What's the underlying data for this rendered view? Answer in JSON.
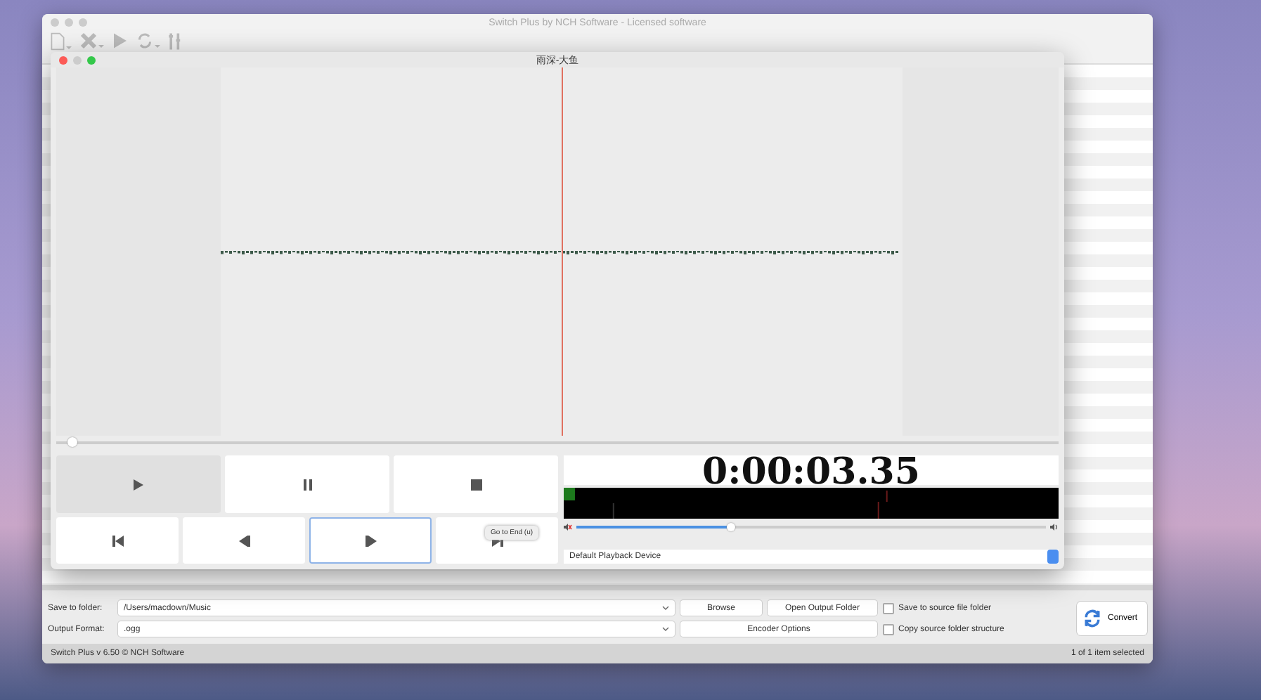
{
  "main_window": {
    "title": "Switch Plus by NCH Software - Licensed software",
    "toolbar": [
      {
        "kind": "add"
      },
      {
        "kind": "remove"
      },
      {
        "kind": "play"
      },
      {
        "kind": "convert"
      },
      {
        "kind": "tools"
      }
    ],
    "save_to_folder": {
      "label": "Save to folder:",
      "value": "/Users/macdown/Music"
    },
    "output_format": {
      "label": "Output Format:",
      "value": ".ogg"
    },
    "buttons": [
      "Browse",
      "Open Output Folder",
      "Encoder Options"
    ],
    "checkboxes": [
      {
        "label": "Save to source file folder",
        "checked": false
      },
      {
        "label": "Copy source folder structure",
        "checked": false
      }
    ],
    "convert_button": "Convert",
    "status_bar": {
      "left": "Switch Plus v 6.50 © NCH Software",
      "right": "1 of 1 item selected"
    }
  },
  "player": {
    "title": "雨深-大鱼",
    "position": {
      "level": 0.015
    },
    "buttons": [
      {
        "kind": "play",
        "pressed": true,
        "focused": false
      },
      {
        "kind": "pause",
        "pressed": false,
        "focused": false
      },
      {
        "kind": "stop",
        "pressed": false,
        "focused": false
      },
      {
        "kind": "go-start",
        "pressed": false,
        "focused": false
      },
      {
        "kind": "step-back",
        "pressed": false,
        "focused": false
      },
      {
        "kind": "step-forward",
        "pressed": false,
        "focused": true
      },
      {
        "kind": "go-end",
        "pressed": false,
        "focused": false
      }
    ],
    "tooltip": "Go to End (u)",
    "timer": "0:00:03.35",
    "volume": {
      "level": 0.33
    },
    "device": "Default Playback Device"
  }
}
